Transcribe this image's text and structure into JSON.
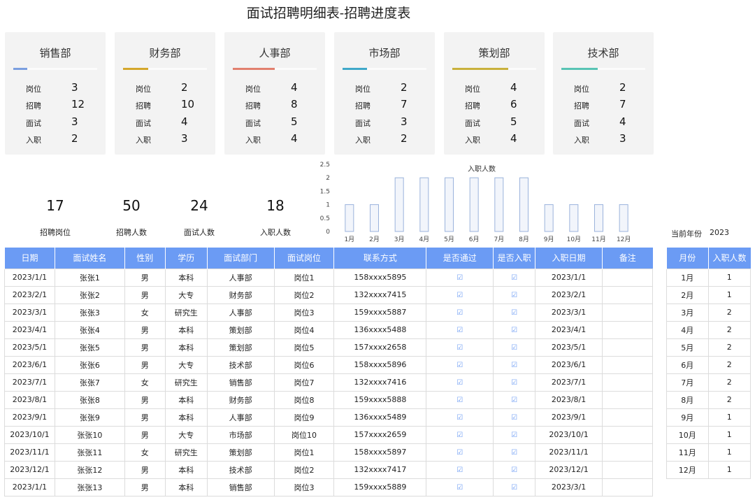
{
  "title": "面试招聘明细表-招聘进度表",
  "stat_labels": {
    "positions": "岗位",
    "recruit": "招聘",
    "interview": "面试",
    "onboard": "入职"
  },
  "departments": [
    {
      "name": "销售部",
      "color": "#7b9fe0",
      "progress": 0.17,
      "positions": "3",
      "recruit": "12",
      "interview": "3",
      "onboard": "2"
    },
    {
      "name": "财务部",
      "color": "#d4a72c",
      "progress": 0.3,
      "positions": "2",
      "recruit": "10",
      "interview": "4",
      "onboard": "3"
    },
    {
      "name": "人事部",
      "color": "#e2806e",
      "progress": 0.5,
      "positions": "4",
      "recruit": "8",
      "interview": "5",
      "onboard": "4"
    },
    {
      "name": "市场部",
      "color": "#3fa8c9",
      "progress": 0.29,
      "positions": "2",
      "recruit": "7",
      "interview": "3",
      "onboard": "2"
    },
    {
      "name": "策划部",
      "color": "#c9b13c",
      "progress": 0.67,
      "positions": "4",
      "recruit": "6",
      "interview": "5",
      "onboard": "4"
    },
    {
      "name": "技术部",
      "color": "#58c4b4",
      "progress": 0.43,
      "positions": "2",
      "recruit": "7",
      "interview": "4",
      "onboard": "3"
    }
  ],
  "kpis": [
    {
      "value": "17",
      "label": "招聘岗位"
    },
    {
      "value": "50",
      "label": "招聘人数"
    },
    {
      "value": "24",
      "label": "面试人数"
    },
    {
      "value": "18",
      "label": "入职人数"
    }
  ],
  "chart_data": {
    "type": "bar",
    "title": "入职人数",
    "categories": [
      "1月",
      "2月",
      "3月",
      "4月",
      "5月",
      "6月",
      "7月",
      "8月",
      "9月",
      "10月",
      "11月",
      "12月"
    ],
    "values": [
      1,
      1,
      2,
      2,
      2,
      2,
      2,
      2,
      1,
      1,
      1,
      1
    ],
    "yticks": [
      "0",
      "0.5",
      "1",
      "1.5",
      "2",
      "2.5"
    ],
    "ylim": [
      0,
      2.5
    ],
    "bar_color": "#f2f5fb",
    "bar_border": "#9bb3dc"
  },
  "year": {
    "label": "当前年份",
    "value": "2023"
  },
  "table": {
    "headers": [
      "日期",
      "面试姓名",
      "性别",
      "学历",
      "面试部门",
      "面试岗位",
      "联系方式",
      "是否通过",
      "是否入职",
      "入职日期",
      "备注"
    ],
    "check_symbol": "☑",
    "rows": [
      [
        "2023/1/1",
        "张张1",
        "男",
        "本科",
        "人事部",
        "岗位1",
        "158xxxx5895",
        "☑",
        "☑",
        "2023/1/1",
        ""
      ],
      [
        "2023/2/1",
        "张张2",
        "男",
        "大专",
        "财务部",
        "岗位2",
        "132xxxx7415",
        "☑",
        "☑",
        "2023/2/1",
        ""
      ],
      [
        "2023/3/1",
        "张张3",
        "女",
        "研究生",
        "人事部",
        "岗位3",
        "159xxxx5887",
        "☑",
        "☑",
        "2023/3/1",
        ""
      ],
      [
        "2023/4/1",
        "张张4",
        "男",
        "本科",
        "策划部",
        "岗位4",
        "136xxxx5488",
        "☑",
        "☑",
        "2023/4/1",
        ""
      ],
      [
        "2023/5/1",
        "张张5",
        "男",
        "本科",
        "策划部",
        "岗位5",
        "157xxxx2658",
        "☑",
        "☑",
        "2023/5/1",
        ""
      ],
      [
        "2023/6/1",
        "张张6",
        "男",
        "大专",
        "技术部",
        "岗位6",
        "158xxxx5896",
        "☑",
        "☑",
        "2023/6/1",
        ""
      ],
      [
        "2023/7/1",
        "张张7",
        "女",
        "研究生",
        "销售部",
        "岗位7",
        "132xxxx7416",
        "☑",
        "☑",
        "2023/7/1",
        ""
      ],
      [
        "2023/8/1",
        "张张8",
        "男",
        "本科",
        "财务部",
        "岗位8",
        "159xxxx5888",
        "☑",
        "☑",
        "2023/8/1",
        ""
      ],
      [
        "2023/9/1",
        "张张9",
        "男",
        "本科",
        "人事部",
        "岗位9",
        "136xxxx5489",
        "☑",
        "☑",
        "2023/9/1",
        ""
      ],
      [
        "2023/10/1",
        "张张10",
        "男",
        "大专",
        "市场部",
        "岗位10",
        "157xxxx2659",
        "☑",
        "☑",
        "2023/10/1",
        ""
      ],
      [
        "2023/11/1",
        "张张11",
        "女",
        "研究生",
        "策划部",
        "岗位1",
        "158xxxx5897",
        "☑",
        "☑",
        "2023/11/1",
        ""
      ],
      [
        "2023/12/1",
        "张张12",
        "男",
        "本科",
        "技术部",
        "岗位2",
        "132xxxx7417",
        "☑",
        "☑",
        "2023/12/1",
        ""
      ],
      [
        "2023/1/1",
        "张张13",
        "男",
        "本科",
        "销售部",
        "岗位3",
        "159xxxx5889",
        "☑",
        "☑",
        "2023/3/1",
        ""
      ]
    ]
  },
  "month_table": {
    "headers": [
      "月份",
      "入职人数"
    ],
    "rows": [
      [
        "1月",
        "1"
      ],
      [
        "2月",
        "1"
      ],
      [
        "3月",
        "2"
      ],
      [
        "4月",
        "2"
      ],
      [
        "5月",
        "2"
      ],
      [
        "6月",
        "2"
      ],
      [
        "7月",
        "2"
      ],
      [
        "8月",
        "2"
      ],
      [
        "9月",
        "1"
      ],
      [
        "10月",
        "1"
      ],
      [
        "11月",
        "1"
      ],
      [
        "12月",
        "1"
      ]
    ]
  }
}
